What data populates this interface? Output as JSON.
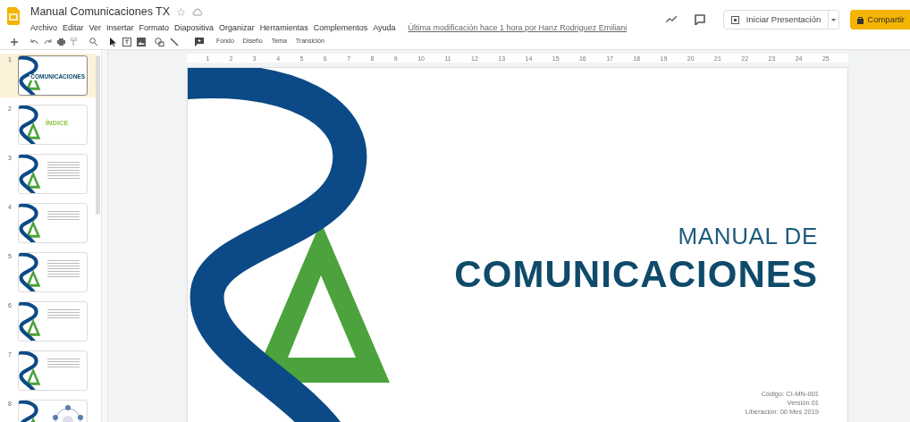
{
  "document": {
    "title": "Manual Comunicaciones TX",
    "starred": false,
    "last_edit": "Última modificación hace 1 hora por Hanz Rodriguez Emiliani"
  },
  "menu": [
    "Archivo",
    "Editar",
    "Ver",
    "Insertar",
    "Formato",
    "Diapositiva",
    "Organizar",
    "Herramientas",
    "Complementos",
    "Ayuda"
  ],
  "header_buttons": {
    "present": "Iniciar Presentación",
    "share": "Compartir"
  },
  "toolbar": {
    "text_buttons": [
      "Fondo",
      "Diseño",
      "Tema",
      "Transición"
    ]
  },
  "slides": [
    {
      "number": "1",
      "selected": true,
      "kind": "title",
      "heading": "COMUNICACIONES"
    },
    {
      "number": "2",
      "selected": false,
      "kind": "heading",
      "heading": "ÍNDICE"
    },
    {
      "number": "3",
      "selected": false,
      "kind": "list"
    },
    {
      "number": "4",
      "selected": false,
      "kind": "paragraph"
    },
    {
      "number": "5",
      "selected": false,
      "kind": "list"
    },
    {
      "number": "6",
      "selected": false,
      "kind": "paragraph"
    },
    {
      "number": "7",
      "selected": false,
      "kind": "paragraph"
    },
    {
      "number": "8",
      "selected": false,
      "kind": "diagram"
    }
  ],
  "ruler": [
    "1",
    "2",
    "3",
    "4",
    "5",
    "6",
    "7",
    "8",
    "9",
    "10",
    "11",
    "12",
    "13",
    "14",
    "15",
    "16",
    "17",
    "18",
    "19",
    "20",
    "21",
    "22",
    "23",
    "24",
    "25"
  ],
  "slide": {
    "title_line_1": "MANUAL DE",
    "title_line_2": "COMUNICACIONES",
    "footer": [
      "Código: CI-MN-001",
      "Versión 01",
      "Liberación: 00 Mes 2019"
    ]
  }
}
